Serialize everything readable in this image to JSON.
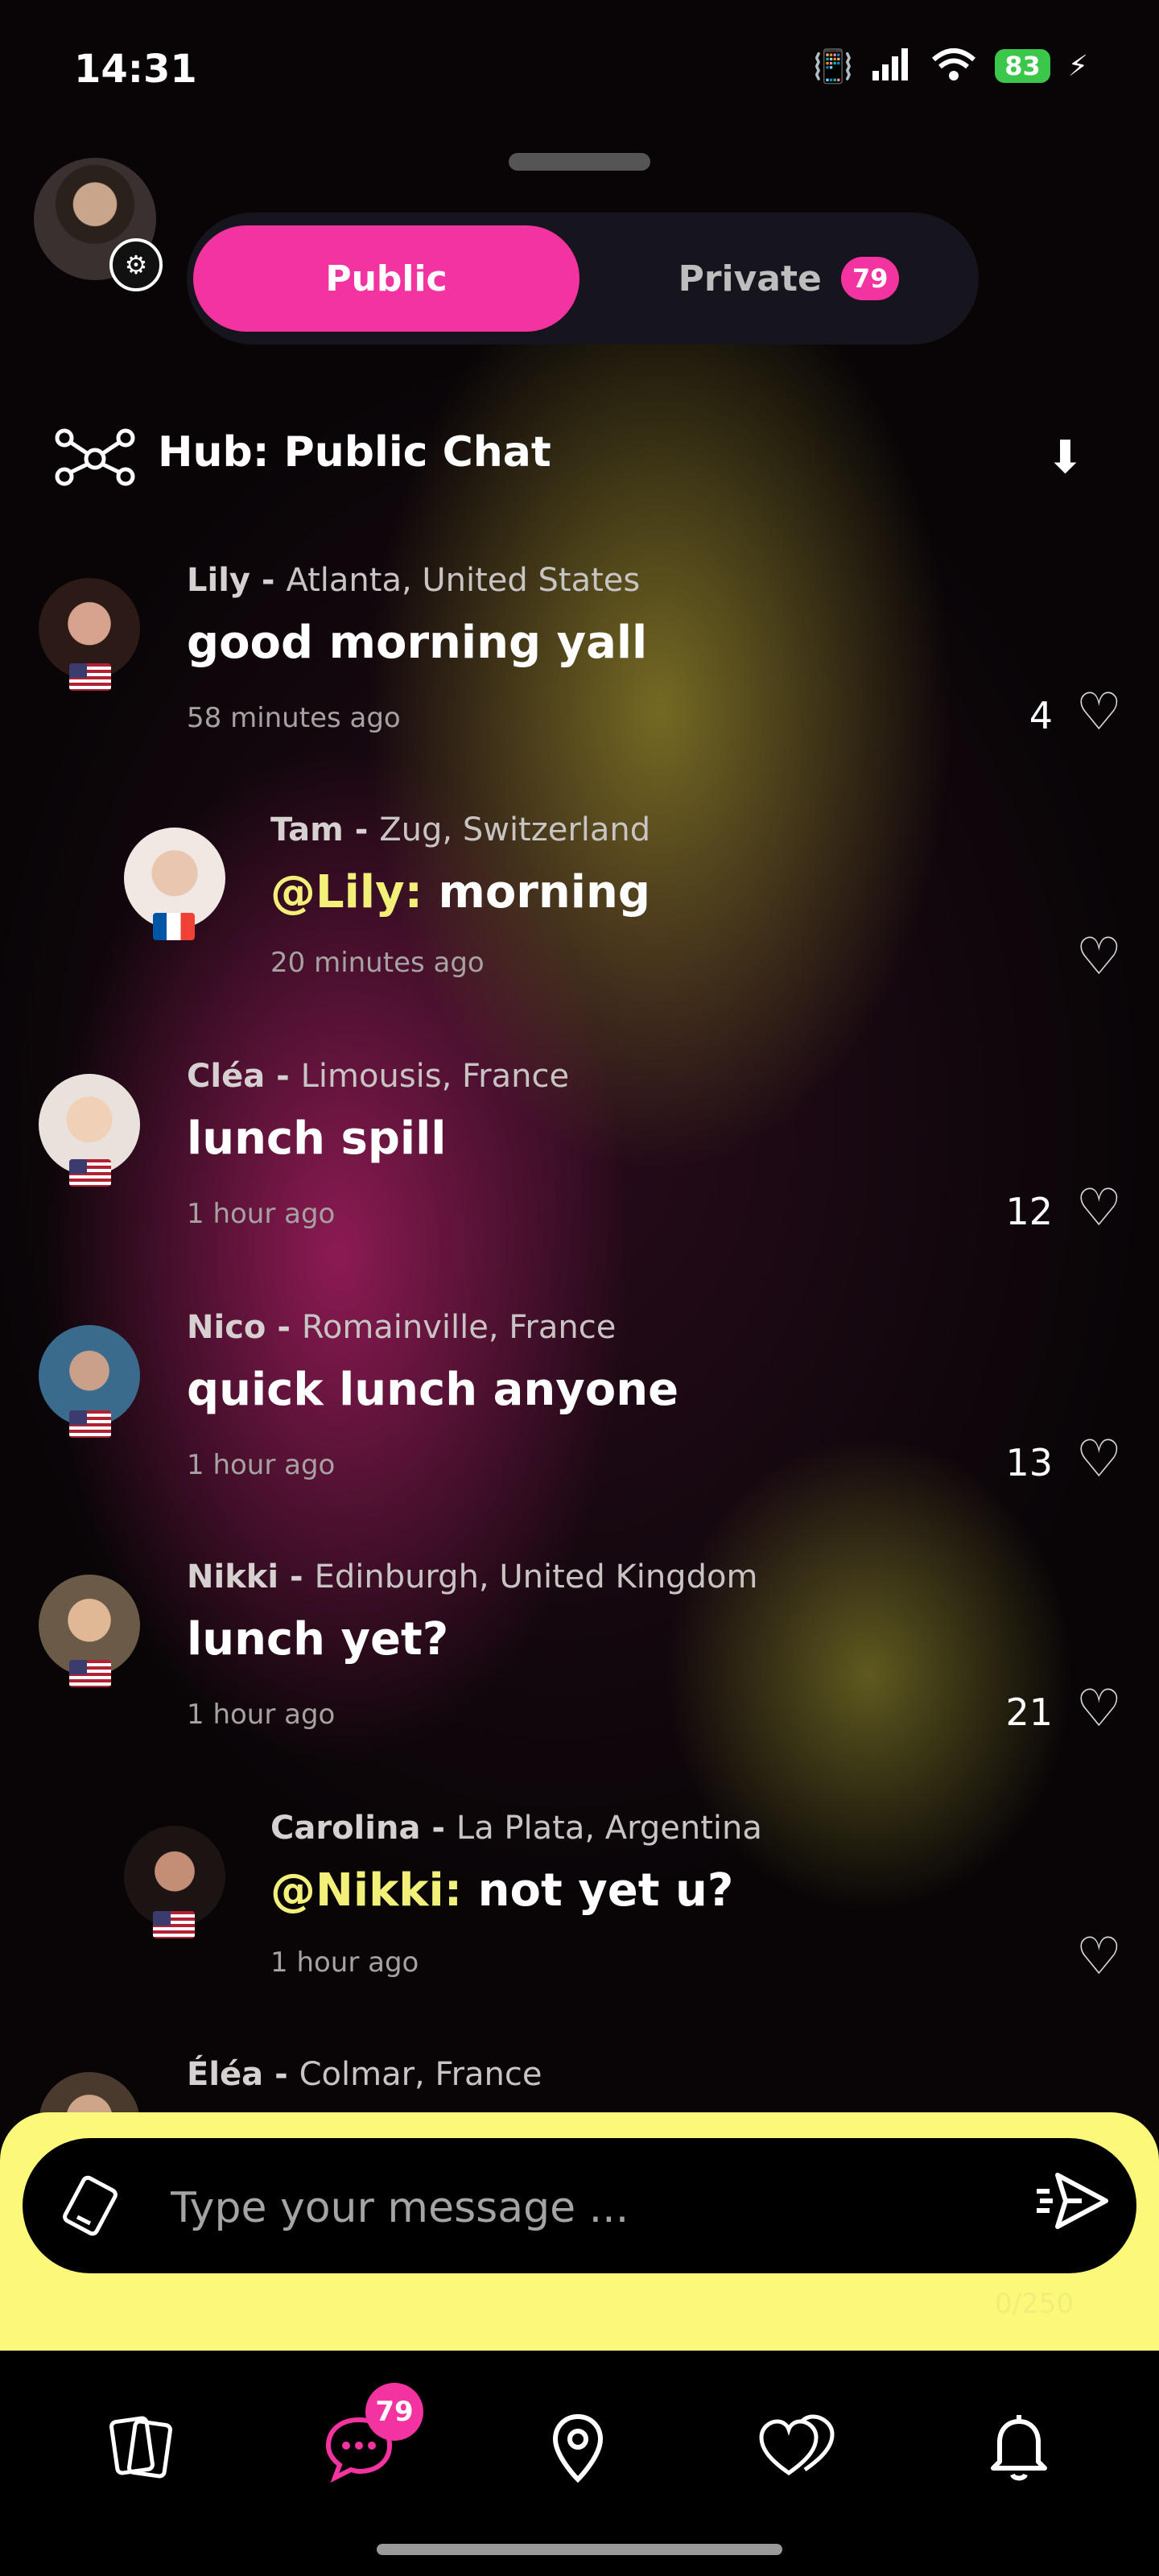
{
  "status_bar": {
    "time": "14:31",
    "battery": "83"
  },
  "tabs": {
    "public_label": "Public",
    "private_label": "Private",
    "private_badge": "79"
  },
  "hub": {
    "title": "Hub: Public Chat"
  },
  "messages": [
    {
      "name": "Lily",
      "sep": " - ",
      "location": "Atlanta, United States",
      "mention": "",
      "text": "good morning yall",
      "time": "58 minutes ago",
      "likes": "4",
      "reply": false,
      "flag": "us"
    },
    {
      "name": "Tam",
      "sep": " - ",
      "location": "Zug, Switzerland",
      "mention": "@Lily:",
      "text": " morning",
      "time": "20 minutes ago",
      "likes": "",
      "reply": true,
      "flag": "fr"
    },
    {
      "name": "Cléa",
      "sep": " - ",
      "location": "Limousis, France",
      "mention": "",
      "text": "lunch spill",
      "time": "1 hour ago",
      "likes": "12",
      "reply": false,
      "flag": "us"
    },
    {
      "name": "Nico",
      "sep": " - ",
      "location": "Romainville, France",
      "mention": "",
      "text": "quick lunch anyone",
      "time": "1 hour ago",
      "likes": "13",
      "reply": false,
      "flag": "us"
    },
    {
      "name": "Nikki",
      "sep": " - ",
      "location": "Edinburgh, United Kingdom",
      "mention": "",
      "text": "lunch yet?",
      "time": "1 hour ago",
      "likes": "21",
      "reply": false,
      "flag": "us"
    },
    {
      "name": "Carolina",
      "sep": " - ",
      "location": "La Plata, Argentina",
      "mention": "@Nikki:",
      "text": " not yet u?",
      "time": "1 hour ago",
      "likes": "",
      "reply": true,
      "flag": "us"
    },
    {
      "name": "Éléa",
      "sep": " - ",
      "location": "Colmar, France",
      "mention": "",
      "text": "",
      "time": "",
      "likes": "",
      "reply": false,
      "flag": ""
    }
  ],
  "composer": {
    "placeholder": "Type your message ...",
    "char_count": "0/250"
  },
  "bottom_nav": {
    "chat_badge": "79"
  },
  "colors": {
    "accent": "#f233a0",
    "composer_bg": "#fcf97a",
    "mention": "#f3f07a"
  }
}
